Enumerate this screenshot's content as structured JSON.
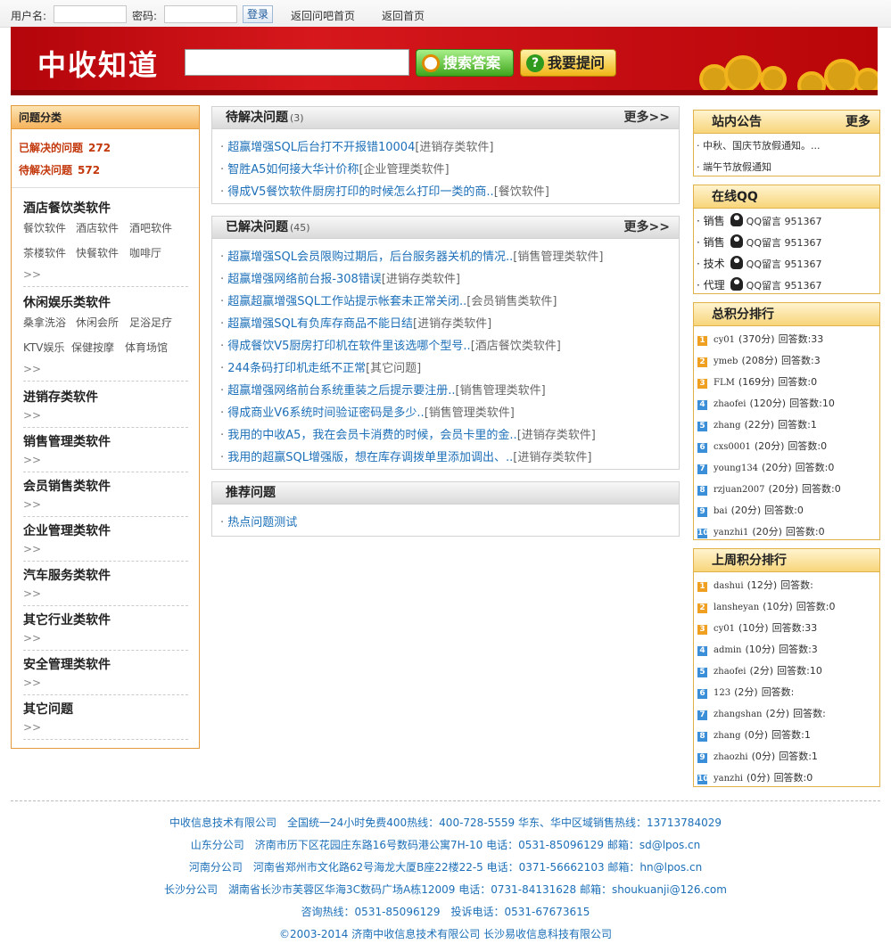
{
  "topbar": {
    "username_label": "用户名:",
    "password_label": "密码:",
    "login_label": "登录",
    "link_qa_home": "返回问吧首页",
    "link_home": "返回首页"
  },
  "header": {
    "logo": "中收知道",
    "search_label": "搜索答案",
    "ask_label": "我要提问",
    "search_value": ""
  },
  "sidebar": {
    "title": "问题分类",
    "solved_label": "已解决的问题",
    "solved_count": "272",
    "pending_label": "待解决问题",
    "pending_count": "572",
    "more": ">>",
    "categories": [
      {
        "title": "酒店餐饮类软件",
        "subs": [
          "餐饮软件",
          "酒店软件",
          "酒吧软件",
          "茶楼软件",
          "快餐软件",
          "咖啡厅"
        ]
      },
      {
        "title": "休闲娱乐类软件",
        "subs": [
          "桑拿洗浴",
          "休闲会所",
          "足浴足疗",
          "KTV娱乐",
          "保健按摩",
          "体育场馆"
        ]
      },
      {
        "title": "进销存类软件",
        "subs": []
      },
      {
        "title": "销售管理类软件",
        "subs": []
      },
      {
        "title": "会员销售类软件",
        "subs": []
      },
      {
        "title": "企业管理类软件",
        "subs": []
      },
      {
        "title": "汽车服务类软件",
        "subs": []
      },
      {
        "title": "其它行业类软件",
        "subs": []
      },
      {
        "title": "安全管理类软件",
        "subs": []
      },
      {
        "title": "其它问题",
        "subs": []
      }
    ]
  },
  "pending": {
    "title": "待解决问题",
    "count": "(3)",
    "more": "更多>>",
    "items": [
      {
        "text": "超赢增强SQL后台打不开报错10004",
        "cat": "[进销存类软件]"
      },
      {
        "text": "智胜A5如何接大华计价称",
        "cat": "[企业管理类软件]"
      },
      {
        "text": "得成V5餐饮软件厨房打印的时候怎么打印一类的商..",
        "cat": "[餐饮软件]"
      }
    ]
  },
  "solved": {
    "title": "已解决问题",
    "count": "(45)",
    "more": "更多>>",
    "items": [
      {
        "text": "超赢增强SQL会员限购过期后，后台服务器关机的情况..",
        "cat": "[销售管理类软件]"
      },
      {
        "text": "超赢增强网络前台报-308错误",
        "cat": "[进销存类软件]"
      },
      {
        "text": "超赢超赢增强SQL工作站提示帐套未正常关闭..",
        "cat": "[会员销售类软件]"
      },
      {
        "text": "超赢增强SQL有负库存商品不能日结",
        "cat": "[进销存类软件]"
      },
      {
        "text": "得成餐饮V5厨房打印机在软件里该选哪个型号..",
        "cat": "[酒店餐饮类软件]"
      },
      {
        "text": "244条码打印机走纸不正常",
        "cat": "[其它问题]"
      },
      {
        "text": "超赢增强网络前台系统重装之后提示要注册..",
        "cat": "[销售管理类软件]"
      },
      {
        "text": "得成商业V6系统时间验证密码是多少..",
        "cat": "[销售管理类软件]"
      },
      {
        "text": "我用的中收A5，我在会员卡消费的时候，会员卡里的金..",
        "cat": "[进销存类软件]"
      },
      {
        "text": "我用的超赢SQL增强版，想在库存调拨单里添加调出、..",
        "cat": "[进销存类软件]"
      }
    ]
  },
  "recommend": {
    "title": "推荐问题",
    "items": [
      {
        "text": "热点问题测试"
      }
    ]
  },
  "notice": {
    "title": "站内公告",
    "more": "更多",
    "items": [
      "中秋、国庆节放假通知。...",
      "端午节放假通知"
    ]
  },
  "qq": {
    "title": "在线QQ",
    "items": [
      {
        "role": "销售",
        "text": "QQ留言 951367"
      },
      {
        "role": "销售",
        "text": "QQ留言 951367"
      },
      {
        "role": "技术",
        "text": "QQ留言 951367"
      },
      {
        "role": "代理",
        "text": "QQ留言 951367"
      }
    ]
  },
  "total_rank": {
    "title": "总积分排行",
    "items": [
      {
        "no": "1",
        "user": "cy01",
        "score": "(370分)",
        "answers": "回答数:33"
      },
      {
        "no": "2",
        "user": "ymeb",
        "score": "(208分)",
        "answers": "回答数:3"
      },
      {
        "no": "3",
        "user": "FLM",
        "score": "(169分)",
        "answers": "回答数:0"
      },
      {
        "no": "4",
        "user": "zhaofei",
        "score": "(120分)",
        "answers": "回答数:10"
      },
      {
        "no": "5",
        "user": "zhang",
        "score": "(22分)",
        "answers": "回答数:1"
      },
      {
        "no": "6",
        "user": "cxs0001",
        "score": "(20分)",
        "answers": "回答数:0"
      },
      {
        "no": "7",
        "user": "young134",
        "score": "(20分)",
        "answers": "回答数:0"
      },
      {
        "no": "8",
        "user": "rzjuan2007",
        "score": "(20分)",
        "answers": "回答数:0"
      },
      {
        "no": "9",
        "user": "bai",
        "score": "(20分)",
        "answers": "回答数:0"
      },
      {
        "no": "10",
        "user": "yanzhi1",
        "score": "(20分)",
        "answers": "回答数:0"
      }
    ]
  },
  "week_rank": {
    "title": "上周积分排行",
    "items": [
      {
        "no": "1",
        "user": "dashui",
        "score": "(12分)",
        "answers": "回答数:"
      },
      {
        "no": "2",
        "user": "lansheyan",
        "score": "(10分)",
        "answers": "回答数:0"
      },
      {
        "no": "3",
        "user": "cy01",
        "score": "(10分)",
        "answers": "回答数:33"
      },
      {
        "no": "4",
        "user": "admin",
        "score": "(10分)",
        "answers": "回答数:3"
      },
      {
        "no": "5",
        "user": "zhaofei",
        "score": "(2分)",
        "answers": "回答数:10"
      },
      {
        "no": "6",
        "user": "123",
        "score": "(2分)",
        "answers": "回答数:"
      },
      {
        "no": "7",
        "user": "zhangshan",
        "score": "(2分)",
        "answers": "回答数:"
      },
      {
        "no": "8",
        "user": "zhang",
        "score": "(0分)",
        "answers": "回答数:1"
      },
      {
        "no": "9",
        "user": "zhaozhi",
        "score": "(0分)",
        "answers": "回答数:1"
      },
      {
        "no": "10",
        "user": "yanzhi",
        "score": "(0分)",
        "answers": "回答数:0"
      }
    ]
  },
  "footer": {
    "lines": [
      "中收信息技术有限公司　全国统一24小时免费400热线：400-728-5559 华东、华中区域销售热线：13713784029",
      "山东分公司　济南市历下区花园庄东路16号数码港公寓7H-10 电话：0531-85096129 邮箱：sd@lpos.cn",
      "河南分公司　河南省郑州市文化路62号海龙大厦B座22楼22-5 电话：0371-56662103 邮箱：hn@lpos.cn",
      "长沙分公司　湖南省长沙市芙蓉区华海3C数码广场A栋12009 电话：0731-84131628 邮箱：shoukuanji@126.com",
      "咨询热线：0531-85096129　投诉电话：0531-67673615",
      "©2003-2014 济南中收信息技术有限公司 长沙易收信息科技有限公司"
    ]
  },
  "colors": {
    "banner_red": "#c40d12",
    "link_blue": "#1c6fb8",
    "stat_orange": "#c3380c",
    "badge_orange": "#f0a020",
    "badge_blue": "#3a8fd8"
  }
}
